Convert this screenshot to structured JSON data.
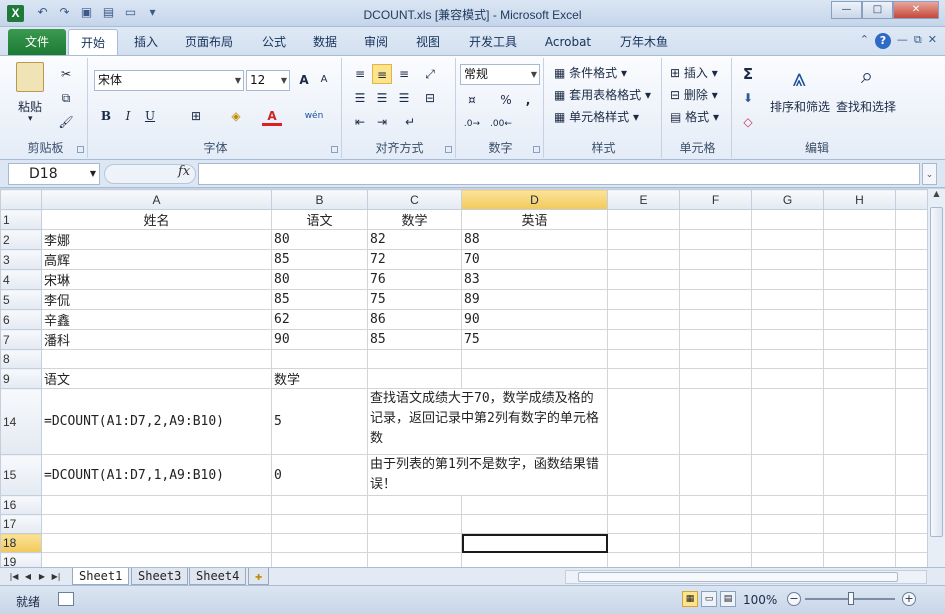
{
  "window": {
    "title": "DCOUNT.xls  [兼容模式] - Microsoft Excel",
    "app_icon": "X"
  },
  "tabs": [
    "文件",
    "开始",
    "插入",
    "页面布局",
    "公式",
    "数据",
    "审阅",
    "视图",
    "开发工具",
    "Acrobat",
    "万年木鱼"
  ],
  "active_tab": "开始",
  "ribbon": {
    "clipboard": {
      "label": "剪贴板",
      "paste": "粘贴"
    },
    "font": {
      "label": "字体",
      "name": "宋体",
      "size": "12",
      "bold": "B",
      "italic": "I",
      "underline": "U",
      "grow": "A",
      "shrink": "A",
      "font_color_label": "A",
      "pinyin": "wén"
    },
    "alignment": {
      "label": "对齐方式"
    },
    "number": {
      "label": "数字",
      "format": "常规",
      "percent": "%",
      "comma": ","
    },
    "styles": {
      "label": "样式",
      "conditional": "条件格式",
      "table": "套用表格格式",
      "cell": "单元格样式"
    },
    "cells": {
      "label": "单元格",
      "insert": "插入",
      "delete": "删除",
      "format": "格式"
    },
    "editing": {
      "label": "编辑",
      "sort": "排序和筛选",
      "find": "查找和选择",
      "sum": "Σ"
    }
  },
  "formula_bar": {
    "name_box": "D18",
    "fx": "fx",
    "formula": ""
  },
  "columns": [
    "A",
    "B",
    "C",
    "D",
    "E",
    "F",
    "G",
    "H"
  ],
  "selected_column": "D",
  "selected_row": "18",
  "rows": [
    {
      "num": "1",
      "cells": [
        "姓名",
        "语文",
        "数学",
        "英语",
        "",
        "",
        "",
        ""
      ],
      "center": true
    },
    {
      "num": "2",
      "cells": [
        "李娜",
        "80",
        "82",
        "88",
        "",
        "",
        "",
        ""
      ]
    },
    {
      "num": "3",
      "cells": [
        "高辉",
        "85",
        "72",
        "70",
        "",
        "",
        "",
        ""
      ]
    },
    {
      "num": "4",
      "cells": [
        "宋琳",
        "80",
        "76",
        "83",
        "",
        "",
        "",
        ""
      ]
    },
    {
      "num": "5",
      "cells": [
        "李侃",
        "85",
        "75",
        "89",
        "",
        "",
        "",
        ""
      ]
    },
    {
      "num": "6",
      "cells": [
        "辛鑫",
        "62",
        "86",
        "90",
        "",
        "",
        "",
        ""
      ]
    },
    {
      "num": "7",
      "cells": [
        "潘科",
        "90",
        "85",
        "75",
        "",
        "",
        "",
        ""
      ]
    },
    {
      "num": "8",
      "cells": [
        "",
        "",
        "",
        "",
        "",
        "",
        "",
        ""
      ]
    },
    {
      "num": "9",
      "cells": [
        "语文",
        "数学",
        "",
        "",
        "",
        "",
        "",
        ""
      ]
    },
    {
      "num": "14",
      "cells": [
        "=DCOUNT(A1:D7,2,A9:B10)",
        "5",
        "查找语文成绩大于70，数学成绩及格的记录，返回记录中第2列有数字的单元格数",
        "",
        "",
        "",
        "",
        ""
      ],
      "tall": true
    },
    {
      "num": "15",
      "cells": [
        "=DCOUNT(A1:D7,1,A9:B10)",
        "0",
        "由于列表的第1列不是数字，函数结果错误！",
        "",
        "",
        "",
        "",
        ""
      ],
      "mid": true
    },
    {
      "num": "16",
      "cells": [
        "",
        "",
        "",
        "",
        "",
        "",
        "",
        ""
      ]
    },
    {
      "num": "17",
      "cells": [
        "",
        "",
        "",
        "",
        "",
        "",
        "",
        ""
      ]
    },
    {
      "num": "18",
      "cells": [
        "",
        "",
        "",
        "",
        "",
        "",
        "",
        ""
      ]
    },
    {
      "num": "19",
      "cells": [
        "",
        "",
        "",
        "",
        "",
        "",
        "",
        ""
      ]
    }
  ],
  "sheets": [
    "Sheet1",
    "Sheet3",
    "Sheet4"
  ],
  "active_sheet": "Sheet1",
  "status": {
    "mode": "就绪",
    "zoom": "100%"
  }
}
